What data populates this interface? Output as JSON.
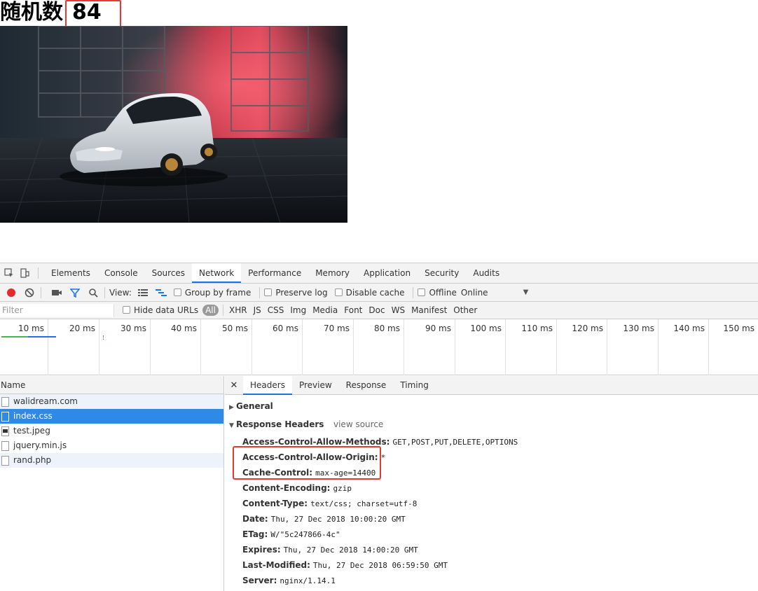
{
  "page": {
    "heading_text": "随机数",
    "random_number": "84"
  },
  "devtools": {
    "main_tabs": [
      "Elements",
      "Console",
      "Sources",
      "Network",
      "Performance",
      "Memory",
      "Application",
      "Security",
      "Audits"
    ],
    "active_tab": "Network",
    "toolbar": {
      "view_label": "View:",
      "group_by_frame": "Group by frame",
      "preserve_log": "Preserve log",
      "disable_cache": "Disable cache",
      "offline": "Offline",
      "throttle_value": "Online"
    },
    "filter": {
      "placeholder": "Filter",
      "hide_data_urls": "Hide data URLs",
      "types": [
        "All",
        "XHR",
        "JS",
        "CSS",
        "Img",
        "Media",
        "Font",
        "Doc",
        "WS",
        "Manifest",
        "Other"
      ]
    },
    "timeline_ticks": [
      "10 ms",
      "20 ms",
      "30 ms",
      "40 ms",
      "50 ms",
      "60 ms",
      "70 ms",
      "80 ms",
      "90 ms",
      "100 ms",
      "110 ms",
      "120 ms",
      "130 ms",
      "140 ms",
      "150 ms"
    ],
    "request_list": {
      "column_name": "Name",
      "requests": [
        "walidream.com",
        "index.css",
        "test.jpeg",
        "jquery.min.js",
        "rand.php"
      ],
      "selected": "index.css"
    },
    "detail": {
      "tabs": [
        "Headers",
        "Preview",
        "Response",
        "Timing"
      ],
      "active_tab": "Headers",
      "general_label": "General",
      "response_headers_label": "Response Headers",
      "view_source": "view source",
      "response_headers": [
        {
          "key": "Access-Control-Allow-Methods:",
          "value": "GET,POST,PUT,DELETE,OPTIONS"
        },
        {
          "key": "Access-Control-Allow-Origin:",
          "value": "*"
        },
        {
          "key": "Cache-Control:",
          "value": "max-age=14400"
        },
        {
          "key": "Content-Encoding:",
          "value": "gzip"
        },
        {
          "key": "Content-Type:",
          "value": "text/css; charset=utf-8"
        },
        {
          "key": "Date:",
          "value": "Thu, 27 Dec 2018 10:00:20 GMT"
        },
        {
          "key": "ETag:",
          "value": "W/\"5c247866-4c\""
        },
        {
          "key": "Expires:",
          "value": "Thu, 27 Dec 2018 14:00:20 GMT"
        },
        {
          "key": "Last-Modified:",
          "value": "Thu, 27 Dec 2018 06:59:50 GMT"
        },
        {
          "key": "Server:",
          "value": "nginx/1.14.1"
        }
      ]
    }
  },
  "colors": {
    "highlight_red": "#e53935",
    "selection_blue": "#2e8ae6",
    "tab_accent": "#1a73e8",
    "record_red": "#e52b2b",
    "filter_blue": "#1a73e8"
  }
}
